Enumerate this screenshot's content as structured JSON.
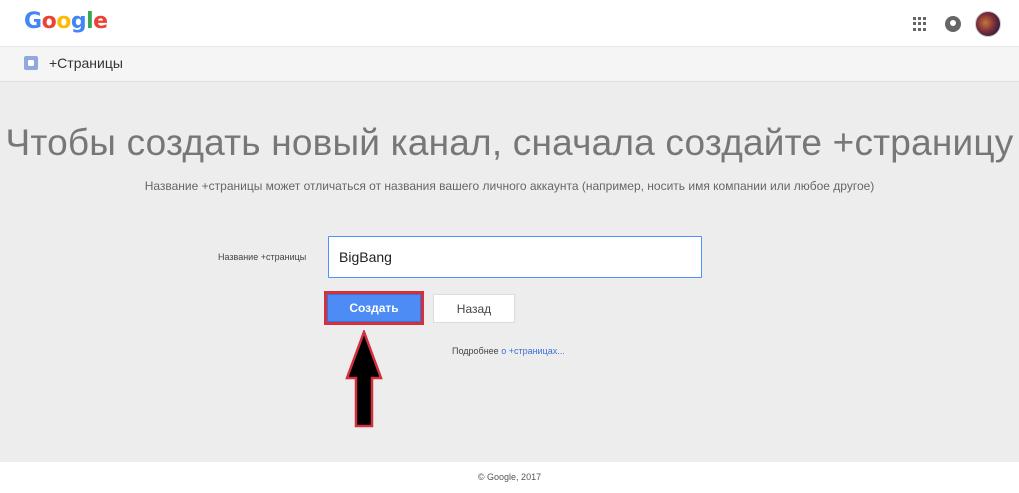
{
  "header": {
    "logo_letters": [
      {
        "char": "G",
        "color": "#4285f4"
      },
      {
        "char": "o",
        "color": "#ea4335"
      },
      {
        "char": "o",
        "color": "#fbbc05"
      },
      {
        "char": "g",
        "color": "#4285f4"
      },
      {
        "char": "l",
        "color": "#34a853"
      },
      {
        "char": "e",
        "color": "#ea4335"
      }
    ],
    "icons": [
      "apps-grid-icon",
      "notifications-icon",
      "avatar"
    ]
  },
  "subbar": {
    "icon": "pages-icon",
    "title": "+Страницы"
  },
  "main": {
    "headline": "Чтобы создать новый канал, сначала создайте +страницу",
    "subline": "Название +страницы может отличаться от названия вашего личного аккаунта (например, носить имя компании или любое другое)",
    "field_label": "Название +страницы",
    "field_value": "BigBang",
    "create_button": "Создать",
    "back_button": "Назад",
    "more_prefix": "Подробнее ",
    "more_link": "о +страницах..."
  },
  "footer": {
    "text": "© Google, 2017"
  },
  "colors": {
    "accent_blue": "#4d8bf5",
    "highlight_red": "#d32f3c",
    "background": "#ededed"
  }
}
